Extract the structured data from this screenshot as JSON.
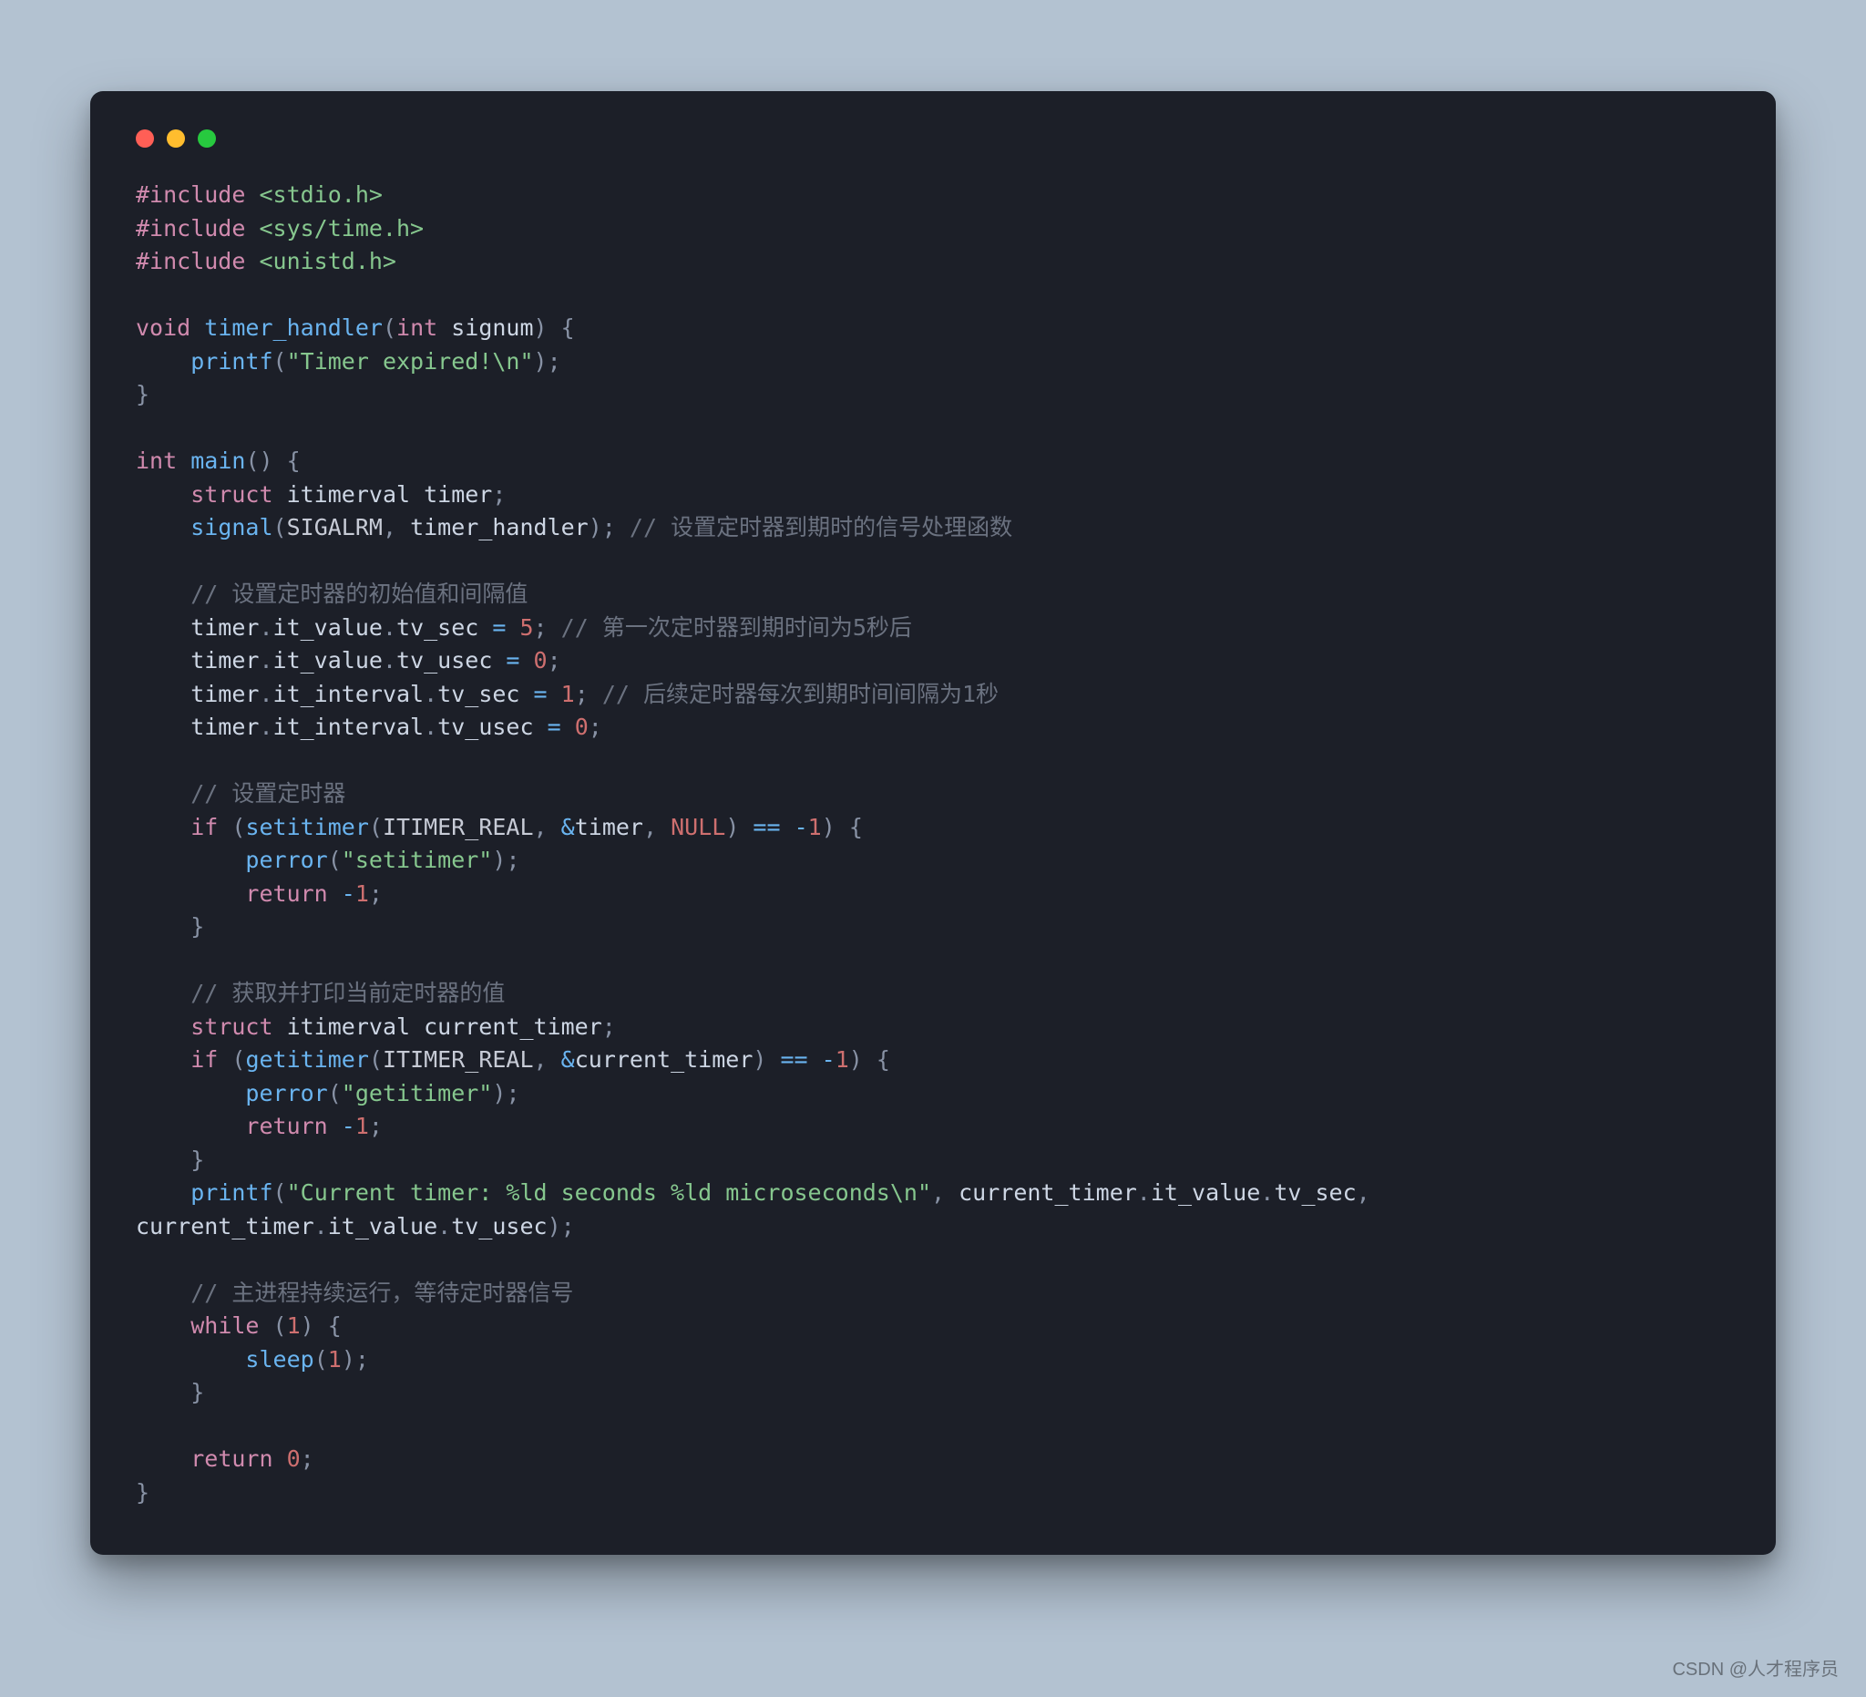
{
  "window_controls": {
    "close": "close",
    "minimize": "minimize",
    "zoom": "zoom"
  },
  "code_lines": [
    [
      {
        "t": "#include ",
        "c": "pp"
      },
      {
        "t": "<stdio.h>",
        "c": "hdr"
      }
    ],
    [
      {
        "t": "#include ",
        "c": "pp"
      },
      {
        "t": "<sys/time.h>",
        "c": "hdr"
      }
    ],
    [
      {
        "t": "#include ",
        "c": "pp"
      },
      {
        "t": "<unistd.h>",
        "c": "hdr"
      }
    ],
    [],
    [
      {
        "t": "void",
        "c": "kw"
      },
      {
        "t": " ",
        "c": ""
      },
      {
        "t": "timer_handler",
        "c": "fn"
      },
      {
        "t": "(",
        "c": "punc"
      },
      {
        "t": "int",
        "c": "kw"
      },
      {
        "t": " signum",
        "c": "id"
      },
      {
        "t": ")",
        "c": "punc"
      },
      {
        "t": " {",
        "c": "punc"
      }
    ],
    [
      {
        "t": "    ",
        "c": ""
      },
      {
        "t": "printf",
        "c": "fn"
      },
      {
        "t": "(",
        "c": "punc"
      },
      {
        "t": "\"Timer expired!\\n\"",
        "c": "str"
      },
      {
        "t": ")",
        "c": "punc"
      },
      {
        "t": ";",
        "c": "punc"
      }
    ],
    [
      {
        "t": "}",
        "c": "punc"
      }
    ],
    [],
    [
      {
        "t": "int",
        "c": "kw"
      },
      {
        "t": " ",
        "c": ""
      },
      {
        "t": "main",
        "c": "fn"
      },
      {
        "t": "()",
        "c": "punc"
      },
      {
        "t": " {",
        "c": "punc"
      }
    ],
    [
      {
        "t": "    ",
        "c": ""
      },
      {
        "t": "struct",
        "c": "kw"
      },
      {
        "t": " itimerval timer",
        "c": "id"
      },
      {
        "t": ";",
        "c": "punc"
      }
    ],
    [
      {
        "t": "    ",
        "c": ""
      },
      {
        "t": "signal",
        "c": "fn"
      },
      {
        "t": "(",
        "c": "punc"
      },
      {
        "t": "SIGALRM",
        "c": "const"
      },
      {
        "t": ", ",
        "c": "punc"
      },
      {
        "t": "timer_handler",
        "c": "id"
      },
      {
        "t": ")",
        "c": "punc"
      },
      {
        "t": ";",
        "c": "punc"
      },
      {
        "t": " ",
        "c": ""
      },
      {
        "t": "// 设置定时器到期时的信号处理函数",
        "c": "cmt"
      }
    ],
    [],
    [
      {
        "t": "    ",
        "c": ""
      },
      {
        "t": "// 设置定时器的初始值和间隔值",
        "c": "cmt"
      }
    ],
    [
      {
        "t": "    timer",
        "c": "id"
      },
      {
        "t": ".",
        "c": "punc"
      },
      {
        "t": "it_value",
        "c": "id"
      },
      {
        "t": ".",
        "c": "punc"
      },
      {
        "t": "tv_sec",
        "c": "id"
      },
      {
        "t": " = ",
        "c": "op"
      },
      {
        "t": "5",
        "c": "num"
      },
      {
        "t": ";",
        "c": "punc"
      },
      {
        "t": " ",
        "c": ""
      },
      {
        "t": "// 第一次定时器到期时间为5秒后",
        "c": "cmt"
      }
    ],
    [
      {
        "t": "    timer",
        "c": "id"
      },
      {
        "t": ".",
        "c": "punc"
      },
      {
        "t": "it_value",
        "c": "id"
      },
      {
        "t": ".",
        "c": "punc"
      },
      {
        "t": "tv_usec",
        "c": "id"
      },
      {
        "t": " = ",
        "c": "op"
      },
      {
        "t": "0",
        "c": "num"
      },
      {
        "t": ";",
        "c": "punc"
      }
    ],
    [
      {
        "t": "    timer",
        "c": "id"
      },
      {
        "t": ".",
        "c": "punc"
      },
      {
        "t": "it_interval",
        "c": "id"
      },
      {
        "t": ".",
        "c": "punc"
      },
      {
        "t": "tv_sec",
        "c": "id"
      },
      {
        "t": " = ",
        "c": "op"
      },
      {
        "t": "1",
        "c": "num"
      },
      {
        "t": ";",
        "c": "punc"
      },
      {
        "t": " ",
        "c": ""
      },
      {
        "t": "// 后续定时器每次到期时间间隔为1秒",
        "c": "cmt"
      }
    ],
    [
      {
        "t": "    timer",
        "c": "id"
      },
      {
        "t": ".",
        "c": "punc"
      },
      {
        "t": "it_interval",
        "c": "id"
      },
      {
        "t": ".",
        "c": "punc"
      },
      {
        "t": "tv_usec",
        "c": "id"
      },
      {
        "t": " = ",
        "c": "op"
      },
      {
        "t": "0",
        "c": "num"
      },
      {
        "t": ";",
        "c": "punc"
      }
    ],
    [],
    [
      {
        "t": "    ",
        "c": ""
      },
      {
        "t": "// 设置定时器",
        "c": "cmt"
      }
    ],
    [
      {
        "t": "    ",
        "c": ""
      },
      {
        "t": "if",
        "c": "kw"
      },
      {
        "t": " (",
        "c": "punc"
      },
      {
        "t": "setitimer",
        "c": "fn"
      },
      {
        "t": "(",
        "c": "punc"
      },
      {
        "t": "ITIMER_REAL",
        "c": "const"
      },
      {
        "t": ", ",
        "c": "punc"
      },
      {
        "t": "&",
        "c": "op"
      },
      {
        "t": "timer",
        "c": "id"
      },
      {
        "t": ", ",
        "c": "punc"
      },
      {
        "t": "NULL",
        "c": "nullk"
      },
      {
        "t": ")",
        "c": "punc"
      },
      {
        "t": " == ",
        "c": "op"
      },
      {
        "t": "-",
        "c": "minus"
      },
      {
        "t": "1",
        "c": "num"
      },
      {
        "t": ")",
        "c": "punc"
      },
      {
        "t": " {",
        "c": "punc"
      }
    ],
    [
      {
        "t": "        ",
        "c": ""
      },
      {
        "t": "perror",
        "c": "fn"
      },
      {
        "t": "(",
        "c": "punc"
      },
      {
        "t": "\"setitimer\"",
        "c": "str"
      },
      {
        "t": ")",
        "c": "punc"
      },
      {
        "t": ";",
        "c": "punc"
      }
    ],
    [
      {
        "t": "        ",
        "c": ""
      },
      {
        "t": "return",
        "c": "kw"
      },
      {
        "t": " ",
        "c": ""
      },
      {
        "t": "-",
        "c": "minus"
      },
      {
        "t": "1",
        "c": "num"
      },
      {
        "t": ";",
        "c": "punc"
      }
    ],
    [
      {
        "t": "    }",
        "c": "punc"
      }
    ],
    [],
    [
      {
        "t": "    ",
        "c": ""
      },
      {
        "t": "// 获取并打印当前定时器的值",
        "c": "cmt"
      }
    ],
    [
      {
        "t": "    ",
        "c": ""
      },
      {
        "t": "struct",
        "c": "kw"
      },
      {
        "t": " itimerval current_timer",
        "c": "id"
      },
      {
        "t": ";",
        "c": "punc"
      }
    ],
    [
      {
        "t": "    ",
        "c": ""
      },
      {
        "t": "if",
        "c": "kw"
      },
      {
        "t": " (",
        "c": "punc"
      },
      {
        "t": "getitimer",
        "c": "fn"
      },
      {
        "t": "(",
        "c": "punc"
      },
      {
        "t": "ITIMER_REAL",
        "c": "const"
      },
      {
        "t": ", ",
        "c": "punc"
      },
      {
        "t": "&",
        "c": "op"
      },
      {
        "t": "current_timer",
        "c": "id"
      },
      {
        "t": ")",
        "c": "punc"
      },
      {
        "t": " == ",
        "c": "op"
      },
      {
        "t": "-",
        "c": "minus"
      },
      {
        "t": "1",
        "c": "num"
      },
      {
        "t": ")",
        "c": "punc"
      },
      {
        "t": " {",
        "c": "punc"
      }
    ],
    [
      {
        "t": "        ",
        "c": ""
      },
      {
        "t": "perror",
        "c": "fn"
      },
      {
        "t": "(",
        "c": "punc"
      },
      {
        "t": "\"getitimer\"",
        "c": "str"
      },
      {
        "t": ")",
        "c": "punc"
      },
      {
        "t": ";",
        "c": "punc"
      }
    ],
    [
      {
        "t": "        ",
        "c": ""
      },
      {
        "t": "return",
        "c": "kw"
      },
      {
        "t": " ",
        "c": ""
      },
      {
        "t": "-",
        "c": "minus"
      },
      {
        "t": "1",
        "c": "num"
      },
      {
        "t": ";",
        "c": "punc"
      }
    ],
    [
      {
        "t": "    }",
        "c": "punc"
      }
    ],
    [
      {
        "t": "    ",
        "c": ""
      },
      {
        "t": "printf",
        "c": "fn"
      },
      {
        "t": "(",
        "c": "punc"
      },
      {
        "t": "\"Current timer: %ld seconds %ld microseconds\\n\"",
        "c": "str"
      },
      {
        "t": ", ",
        "c": "punc"
      },
      {
        "t": "current_timer",
        "c": "id"
      },
      {
        "t": ".",
        "c": "punc"
      },
      {
        "t": "it_value",
        "c": "id"
      },
      {
        "t": ".",
        "c": "punc"
      },
      {
        "t": "tv_sec",
        "c": "id"
      },
      {
        "t": ", ",
        "c": "punc"
      }
    ],
    [
      {
        "t": "current_timer",
        "c": "id"
      },
      {
        "t": ".",
        "c": "punc"
      },
      {
        "t": "it_value",
        "c": "id"
      },
      {
        "t": ".",
        "c": "punc"
      },
      {
        "t": "tv_usec",
        "c": "id"
      },
      {
        "t": ")",
        "c": "punc"
      },
      {
        "t": ";",
        "c": "punc"
      }
    ],
    [],
    [
      {
        "t": "    ",
        "c": ""
      },
      {
        "t": "// 主进程持续运行，等待定时器信号",
        "c": "cmt"
      }
    ],
    [
      {
        "t": "    ",
        "c": ""
      },
      {
        "t": "while",
        "c": "kw"
      },
      {
        "t": " (",
        "c": "punc"
      },
      {
        "t": "1",
        "c": "num"
      },
      {
        "t": ")",
        "c": "punc"
      },
      {
        "t": " {",
        "c": "punc"
      }
    ],
    [
      {
        "t": "        ",
        "c": ""
      },
      {
        "t": "sleep",
        "c": "fn"
      },
      {
        "t": "(",
        "c": "punc"
      },
      {
        "t": "1",
        "c": "num"
      },
      {
        "t": ")",
        "c": "punc"
      },
      {
        "t": ";",
        "c": "punc"
      }
    ],
    [
      {
        "t": "    }",
        "c": "punc"
      }
    ],
    [],
    [
      {
        "t": "    ",
        "c": ""
      },
      {
        "t": "return",
        "c": "kw"
      },
      {
        "t": " ",
        "c": ""
      },
      {
        "t": "0",
        "c": "num"
      },
      {
        "t": ";",
        "c": "punc"
      }
    ],
    [
      {
        "t": "}",
        "c": "punc"
      }
    ]
  ],
  "watermark": "CSDN @人才程序员"
}
